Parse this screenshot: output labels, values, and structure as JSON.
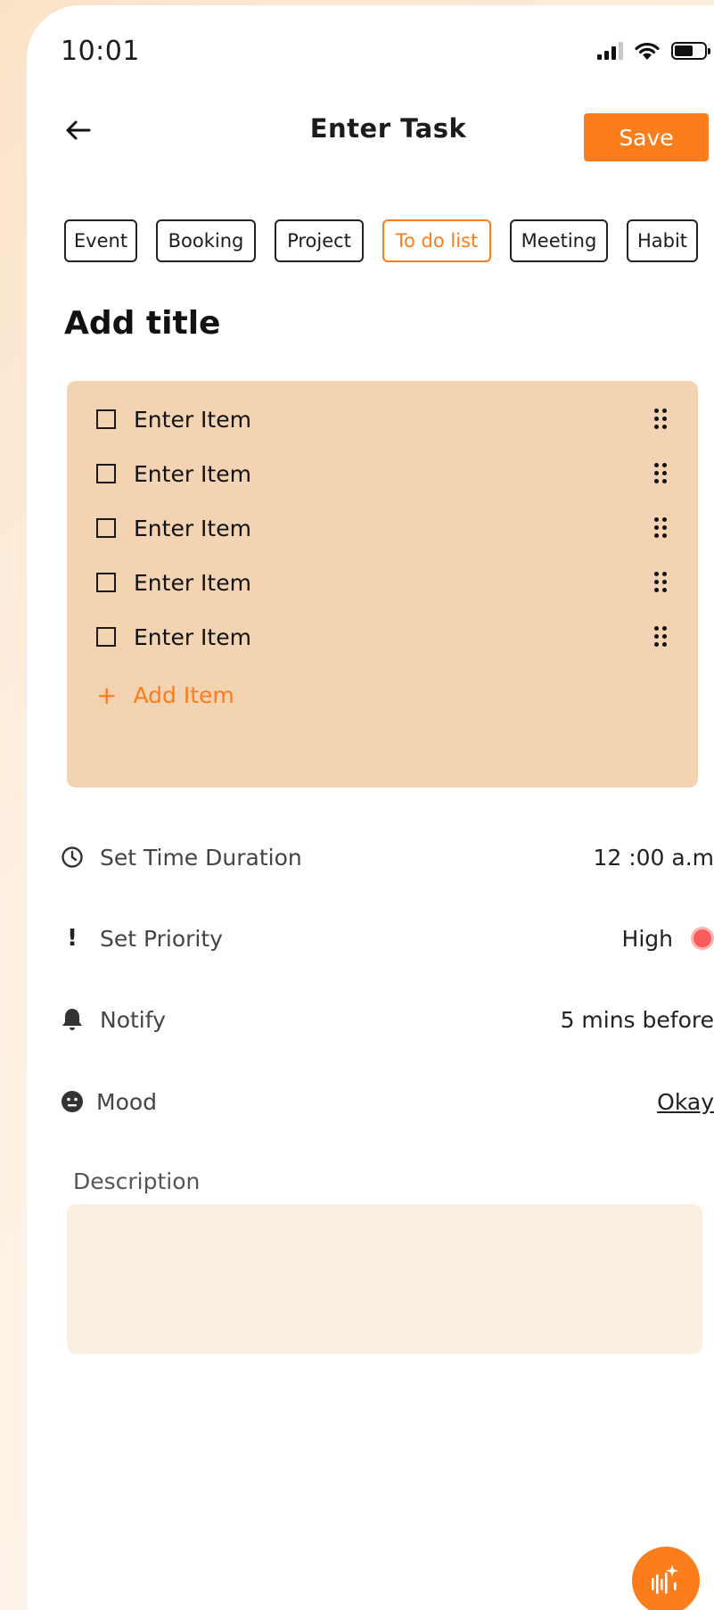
{
  "status_bar": {
    "time": "10:01"
  },
  "header": {
    "title": "Enter  Task",
    "save_label": "Save"
  },
  "categories": [
    {
      "label": "Event"
    },
    {
      "label": "Booking"
    },
    {
      "label": "Project"
    },
    {
      "label": "To do list",
      "active": true
    },
    {
      "label": "Meeting"
    },
    {
      "label": "Habit"
    }
  ],
  "title_placeholder": "Add title",
  "checklist": {
    "items": [
      {
        "label": "Enter Item"
      },
      {
        "label": "Enter Item"
      },
      {
        "label": "Enter Item"
      },
      {
        "label": "Enter Item"
      },
      {
        "label": "Enter Item"
      }
    ],
    "add_label": "Add Item"
  },
  "settings": {
    "time": {
      "label": "Set Time Duration",
      "value": "12 :00 a.m"
    },
    "priority": {
      "label": "Set Priority",
      "value": "High",
      "color": "#fc5b5b"
    },
    "notify": {
      "label": "Notify",
      "value": "5 mins before"
    },
    "mood": {
      "label": "Mood",
      "value": "Okay"
    }
  },
  "description": {
    "label": "Description"
  },
  "colors": {
    "accent": "#fb7d1b",
    "card": "#f4d3b3",
    "description_bg": "#fbefe4"
  },
  "icons": [
    "back-arrow-icon",
    "checkbox-icon",
    "drag-handle-icon",
    "plus-icon",
    "clock-icon",
    "exclamation-icon",
    "bell-icon",
    "neutral-face-icon",
    "voice-ai-icon"
  ]
}
